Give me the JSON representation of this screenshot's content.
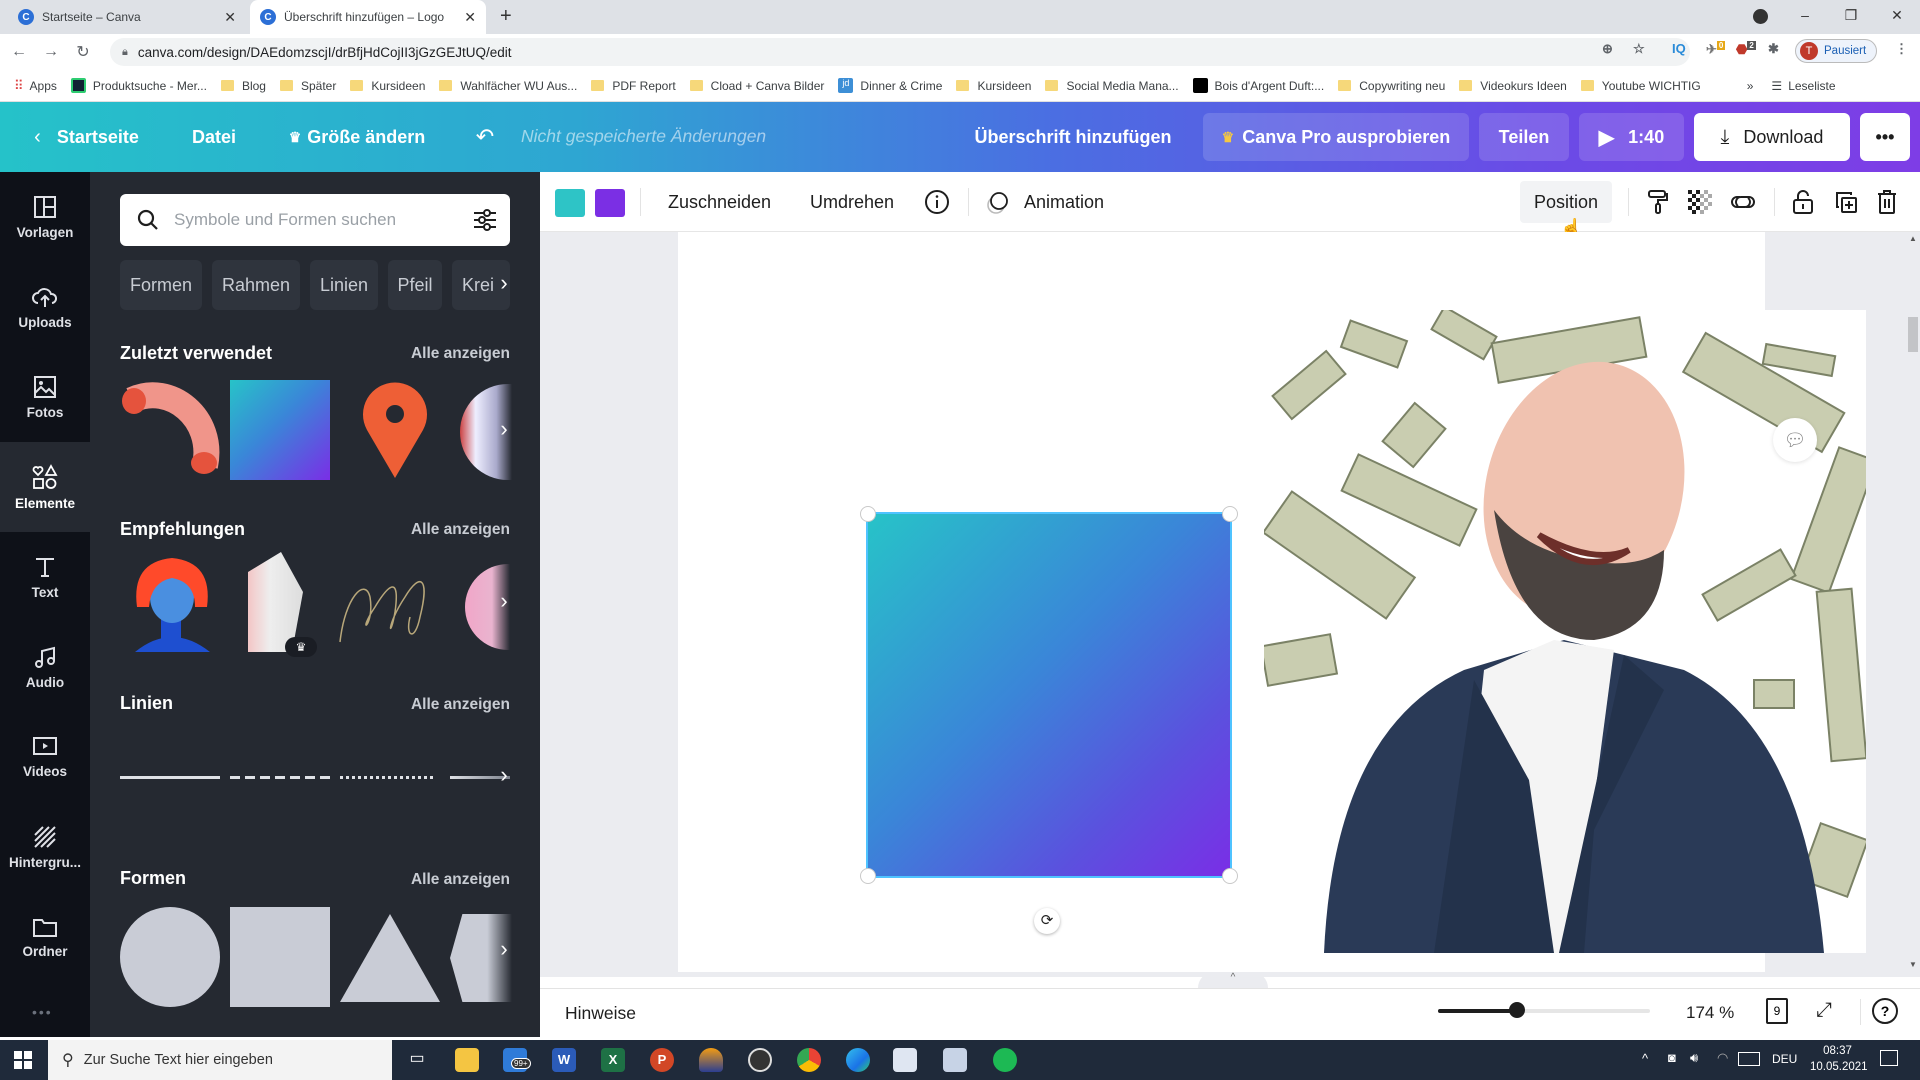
{
  "browser": {
    "tabs": [
      {
        "title": "Startseite – Canva",
        "active": false
      },
      {
        "title": "Überschrift hinzufügen – Logo",
        "active": true
      }
    ],
    "url": "canva.com/design/DAEdomzscjI/drBfjHdCojII3jGzGEJtUQ/edit",
    "profile_initial": "T",
    "profile_status": "Pausiert",
    "extension_badges": {
      "ext1": "0",
      "abp": "2"
    },
    "bookmarks": [
      {
        "label": "Apps",
        "type": "apps"
      },
      {
        "label": "Produktsuche - Mer...",
        "type": "site"
      },
      {
        "label": "Blog",
        "type": "folder"
      },
      {
        "label": "Später",
        "type": "folder"
      },
      {
        "label": "Kursideen",
        "type": "folder"
      },
      {
        "label": "Wahlfächer WU Aus...",
        "type": "folder"
      },
      {
        "label": "PDF Report",
        "type": "folder"
      },
      {
        "label": "Cload + Canva Bilder",
        "type": "folder"
      },
      {
        "label": "Dinner & Crime",
        "type": "site"
      },
      {
        "label": "Kursideen",
        "type": "folder"
      },
      {
        "label": "Social Media Mana...",
        "type": "folder"
      },
      {
        "label": "Bois d'Argent Duft:...",
        "type": "site"
      },
      {
        "label": "Copywriting neu",
        "type": "folder"
      },
      {
        "label": "Videokurs Ideen",
        "type": "folder"
      },
      {
        "label": "Youtube WICHTIG",
        "type": "folder"
      }
    ],
    "more_bookmarks": "»",
    "reading_list": "Leseliste"
  },
  "header": {
    "home": "Startseite",
    "file": "Datei",
    "resize": "Größe ändern",
    "unsaved": "Nicht gespeicherte Änderungen",
    "title": "Überschrift hinzufügen",
    "pro": "Canva Pro ausprobieren",
    "share": "Teilen",
    "duration": "1:40",
    "download": "Download",
    "more": "•••"
  },
  "rail": [
    {
      "label": "Vorlagen",
      "icon": "templates-icon"
    },
    {
      "label": "Uploads",
      "icon": "upload-icon"
    },
    {
      "label": "Fotos",
      "icon": "photo-icon"
    },
    {
      "label": "Elemente",
      "icon": "elements-icon",
      "active": true
    },
    {
      "label": "Text",
      "icon": "text-icon"
    },
    {
      "label": "Audio",
      "icon": "audio-icon"
    },
    {
      "label": "Videos",
      "icon": "video-icon"
    },
    {
      "label": "Hintergru...",
      "icon": "background-icon"
    },
    {
      "label": "Ordner",
      "icon": "folder-icon"
    }
  ],
  "panel": {
    "search_placeholder": "Symbole und Formen suchen",
    "chips": [
      "Formen",
      "Rahmen",
      "Linien",
      "Pfeil",
      "Krei"
    ],
    "see_all": "Alle anzeigen",
    "sections": {
      "recent": "Zuletzt verwendet",
      "recommendations": "Empfehlungen",
      "lines": "Linien",
      "shapes": "Formen"
    }
  },
  "toolbar": {
    "colors": [
      "#2ec4c6",
      "#7b2fe4"
    ],
    "crop": "Zuschneiden",
    "flip": "Umdrehen",
    "animation": "Animation",
    "position": "Position"
  },
  "canvas": {
    "shape_gradient": [
      "#27c3c8",
      "#7a2ee6"
    ]
  },
  "footer": {
    "notes": "Hinweise",
    "zoom_percent": 174,
    "zoom_label": "174 %",
    "page_count": "9",
    "help": "?"
  },
  "taskbar": {
    "search_placeholder": "Zur Suche Text hier eingeben",
    "mail_badge": "99+",
    "language": "DEU",
    "time": "08:37",
    "date": "10.05.2021"
  }
}
